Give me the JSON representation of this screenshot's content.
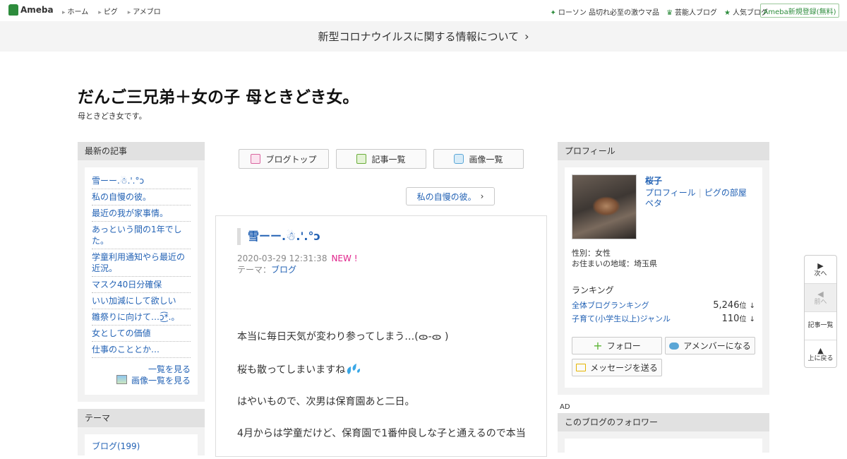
{
  "topbar": {
    "logo": "Ameba",
    "nav": [
      "ホーム",
      "ピグ",
      "アメブロ"
    ],
    "right_links": [
      "ローソン 品切れ必至の激ウマ品",
      "芸能人ブログ",
      "人気ブログ"
    ],
    "signup": "Ameba新規登録(無料)"
  },
  "notice": {
    "text": "新型コロナウイルスに関する情報について",
    "chevron": "›"
  },
  "blog": {
    "title": "だんご三兄弟＋女の子 母ときどき女。",
    "description": "母ときどき女です。"
  },
  "left": {
    "recent_head": "最新の記事",
    "recent_items": [
      "雪ーー.☃.'.°ↄ",
      "私の自慢の彼。",
      "最近の我が家事情。",
      "あっという間の1年でした。",
      "学童利用通知やら最近の近況。",
      "マスク40日分確保",
      "いい加減にして欲しい",
      "雛祭りに向けて…ↄ͜͡*.。",
      "女としての価値",
      "仕事のこととか…"
    ],
    "more": "一覧を見る",
    "images_more": "画像一覧を見る",
    "theme_head": "テーマ",
    "theme_partial": "ブログ(199)"
  },
  "center": {
    "nav_buttons": [
      {
        "label": "ブログトップ",
        "icon": "document-icon"
      },
      {
        "label": "記事一覧",
        "icon": "list-icon"
      },
      {
        "label": "画像一覧",
        "icon": "camera-icon"
      }
    ],
    "prev_post": "私の自慢の彼。",
    "article": {
      "title": "雪ーー.☃.'.°ↄ",
      "datetime": "2020-03-29 12:31:38",
      "new_badge": "NEW !",
      "theme_label": "テーマ：",
      "theme": "ブログ",
      "paragraphs": [
        "本当に毎日天気が変わり参ってしまう…(ᯣ-ᯣ )",
        "桜も散ってしまいますね",
        "はやいもので、次男は保育園あと二日。",
        "4月からは学童だけど、保育園で1番仲良しな子と通えるので本当"
      ]
    }
  },
  "right": {
    "profile_head": "プロフィール",
    "name": "桜子",
    "links": [
      "プロフィール",
      "ピグの部屋",
      "ペタ"
    ],
    "gender": "性別：女性",
    "residence": "お住まいの地域：埼玉県",
    "ranking_label": "ランキング",
    "rankings": [
      {
        "name": "全体ブログランキング",
        "value": "5,246",
        "unit": "位",
        "trend": "↓"
      },
      {
        "name": "子育て(小学生以上)ジャンル",
        "value": "110",
        "unit": "位",
        "trend": "↓"
      }
    ],
    "follow_button": "フォロー",
    "amember_button": "アメンバーになる",
    "message_button": "メッセージを送る",
    "ad_label": "AD",
    "follower_head": "このブログのフォロワー"
  },
  "floatnav": {
    "next": "次へ",
    "prev": "前へ",
    "list": "記事一覧",
    "top": "上に戻る"
  },
  "colors": {
    "accent_green": "#2d8c3c",
    "link_blue": "#2463b5",
    "new_pink": "#e0238b"
  }
}
